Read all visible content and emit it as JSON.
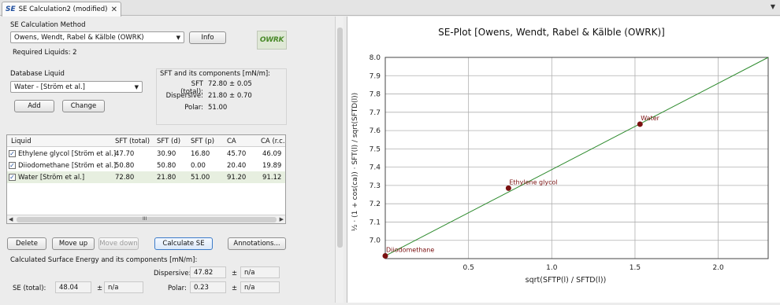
{
  "tab": {
    "icon": "SE",
    "title": "SE Calculation2 (modified)",
    "close": "✕"
  },
  "method": {
    "label": "SE Calculation Method",
    "selected": "Owens, Wendt, Rabel & Kälble (OWRK)",
    "info_button": "Info",
    "required": "Required Liquids: 2",
    "logo": "OWRK"
  },
  "database": {
    "label": "Database Liquid",
    "selected": "Water - [Ström et al.]",
    "add_button": "Add",
    "change_button": "Change"
  },
  "sft_box": {
    "title": "SFT and its components [mN/m]:",
    "rows": [
      {
        "label": "SFT (total):",
        "value": "72.80 ± 0.05"
      },
      {
        "label": "Dispersive:",
        "value": "21.80 ± 0.70"
      },
      {
        "label": "Polar:",
        "value": "51.00"
      }
    ]
  },
  "table": {
    "headers": [
      "Liquid",
      "SFT (total)",
      "SFT (d)",
      "SFT (p)",
      "CA",
      "CA (r.c.)"
    ],
    "rows": [
      {
        "checked": "✓",
        "cells": [
          "Ethylene glycol [Ström et al.]",
          "47.70",
          "30.90",
          "16.80",
          "45.70",
          "46.09"
        ]
      },
      {
        "checked": "✓",
        "cells": [
          "Diiodomethane [Ström et al.]",
          "50.80",
          "50.80",
          "0.00",
          "20.40",
          "19.89"
        ]
      },
      {
        "checked": "✓",
        "cells": [
          "Water [Ström et al.]",
          "72.80",
          "21.80",
          "51.00",
          "91.20",
          "91.12"
        ]
      }
    ],
    "scroll_mark": "III"
  },
  "actions": {
    "delete": "Delete",
    "move_up": "Move up",
    "move_down": "Move down",
    "calculate": "Calculate SE",
    "annotations": "Annotations..."
  },
  "results": {
    "title": "Calculated Surface Energy and its components [mN/m]:",
    "dispersive_label": "Dispersive:",
    "dispersive_value": "47.82",
    "dispersive_pm": "±",
    "dispersive_err": "n/a",
    "se_label": "SE (total):",
    "se_value": "48.04",
    "se_pm": "±",
    "se_err": "n/a",
    "polar_label": "Polar:",
    "polar_value": "0.23",
    "polar_pm": "±",
    "polar_err": "n/a"
  },
  "chart_data": {
    "type": "scatter",
    "title": "SE-Plot [Owens, Wendt, Rabel & Kälble (OWRK)]",
    "xlabel": "sqrt(SFTP(l) / SFTD(l))",
    "ylabel": "½ · (1 + cos(ca)) · SFT(l) / sqrt(SFTD(l))",
    "xlim": [
      0,
      2.3
    ],
    "ylim": [
      6.9,
      8.0
    ],
    "xticks": [
      "0.5",
      "1.0",
      "1.5",
      "2.0"
    ],
    "yticks": [
      "7.0",
      "7.1",
      "7.2",
      "7.3",
      "7.4",
      "7.5",
      "7.6",
      "7.7",
      "7.8",
      "7.9",
      "8.0"
    ],
    "points": [
      {
        "name": "Diiodomethane",
        "x": 0.0,
        "y": 6.915
      },
      {
        "name": "Ethylene glycol",
        "x": 0.74,
        "y": 7.285
      },
      {
        "name": "Water",
        "x": 1.53,
        "y": 7.635
      }
    ],
    "fit_line": {
      "x": [
        0.0,
        2.3
      ],
      "y": [
        6.915,
        8.0
      ]
    },
    "colors": {
      "point": "#7a1010",
      "line": "#2e8b2e",
      "grid": "#b0b0b0"
    },
    "grid": true
  }
}
